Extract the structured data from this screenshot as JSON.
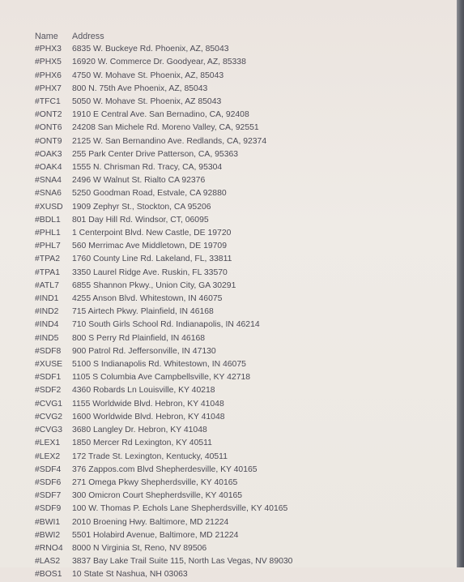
{
  "table": {
    "headers": {
      "name": "Name",
      "address": "Address"
    },
    "rows": [
      {
        "name": "#PHX3",
        "address": "6835 W. Buckeye Rd. Phoenix, AZ, 85043"
      },
      {
        "name": "#PHX5",
        "address": "16920 W. Commerce Dr. Goodyear, AZ, 85338"
      },
      {
        "name": "#PHX6",
        "address": "4750 W. Mohave St. Phoenix, AZ, 85043"
      },
      {
        "name": "#PHX7",
        "address": "800 N. 75th Ave Phoenix, AZ, 85043"
      },
      {
        "name": "#TFC1",
        "address": "5050 W. Mohave St. Phoenix, AZ 85043"
      },
      {
        "name": "#ONT2",
        "address": "1910 E Central Ave. San Bernadino, CA, 92408"
      },
      {
        "name": "#ONT6",
        "address": "24208 San Michele Rd. Moreno Valley, CA, 92551"
      },
      {
        "name": "#ONT9",
        "address": "2125 W. San Bernandino Ave. Redlands, CA, 92374"
      },
      {
        "name": "#OAK3",
        "address": "255 Park Center Drive Patterson, CA, 95363"
      },
      {
        "name": "#OAK4",
        "address": "1555 N. Chrisman Rd. Tracy, CA, 95304"
      },
      {
        "name": "#SNA4",
        "address": "2496 W Walnut St. Rialto CA 92376"
      },
      {
        "name": "#SNA6",
        "address": "5250 Goodman Road, Estvale, CA 92880"
      },
      {
        "name": "#XUSD",
        "address": "1909 Zephyr St., Stockton, CA 95206"
      },
      {
        "name": "#BDL1",
        "address": "801 Day Hill Rd. Windsor, CT, 06095"
      },
      {
        "name": "#PHL1",
        "address": "1 Centerpoint Blvd. New Castle, DE 19720"
      },
      {
        "name": "#PHL7",
        "address": "560 Merrimac Ave Middletown, DE 19709"
      },
      {
        "name": "#TPA2",
        "address": "1760 County Line Rd. Lakeland, FL, 33811"
      },
      {
        "name": "#TPA1",
        "address": "3350 Laurel Ridge Ave. Ruskin, FL 33570"
      },
      {
        "name": "#ATL7",
        "address": "6855 Shannon Pkwy., Union City, GA 30291"
      },
      {
        "name": "#IND1",
        "address": "4255 Anson Blvd. Whitestown, IN 46075"
      },
      {
        "name": "#IND2",
        "address": "715 Airtech Pkwy. Plainfield, IN 46168"
      },
      {
        "name": "#IND4",
        "address": "710 South Girls School Rd. Indianapolis, IN 46214"
      },
      {
        "name": "#IND5",
        "address": "800 S Perry Rd Plainfield, IN 46168"
      },
      {
        "name": "#SDF8",
        "address": "900 Patrol Rd. Jeffersonville, IN 47130"
      },
      {
        "name": "#XUSE",
        "address": "5100 S Indianapolis Rd. Whitestown, IN 46075"
      },
      {
        "name": "#SDF1",
        "address": "1105 S Columbia Ave Campbellsville, KY 42718"
      },
      {
        "name": "#SDF2",
        "address": "4360 Robards Ln Louisville, KY 40218"
      },
      {
        "name": "#CVG1",
        "address": "1155 Worldwide Blvd. Hebron, KY 41048"
      },
      {
        "name": "#CVG2",
        "address": "1600 Worldwide Blvd. Hebron, KY 41048"
      },
      {
        "name": "#CVG3",
        "address": "3680 Langley Dr. Hebron, KY 41048"
      },
      {
        "name": "#LEX1",
        "address": "1850 Mercer Rd Lexington, KY 40511"
      },
      {
        "name": "#LEX2",
        "address": "172 Trade St. Lexington, Kentucky, 40511"
      },
      {
        "name": "#SDF4",
        "address": "376 Zappos.com Blvd Shepherdesville, KY 40165"
      },
      {
        "name": "#SDF6",
        "address": "271 Omega Pkwy Shepherdsville, KY 40165"
      },
      {
        "name": "#SDF7",
        "address": "300 Omicron Court Shepherdsville, KY 40165"
      },
      {
        "name": "#SDF9",
        "address": "100 W. Thomas P. Echols Lane Shepherdsville, KY 40165"
      },
      {
        "name": "#BWI1",
        "address": "2010 Broening Hwy. Baltimore, MD 21224"
      },
      {
        "name": "#BWI2",
        "address": "5501 Holabird Avenue, Baltimore, MD 21224"
      },
      {
        "name": "#RNO4",
        "address": "8000 N Virginia St, Reno, NV 89506"
      },
      {
        "name": "#LAS2",
        "address": "3837 Bay Lake Trail Suite 115, North Las Vegas, NV 89030"
      },
      {
        "name": "#BOS1",
        "address": "10 State St Nashua, NH 03063"
      }
    ]
  }
}
